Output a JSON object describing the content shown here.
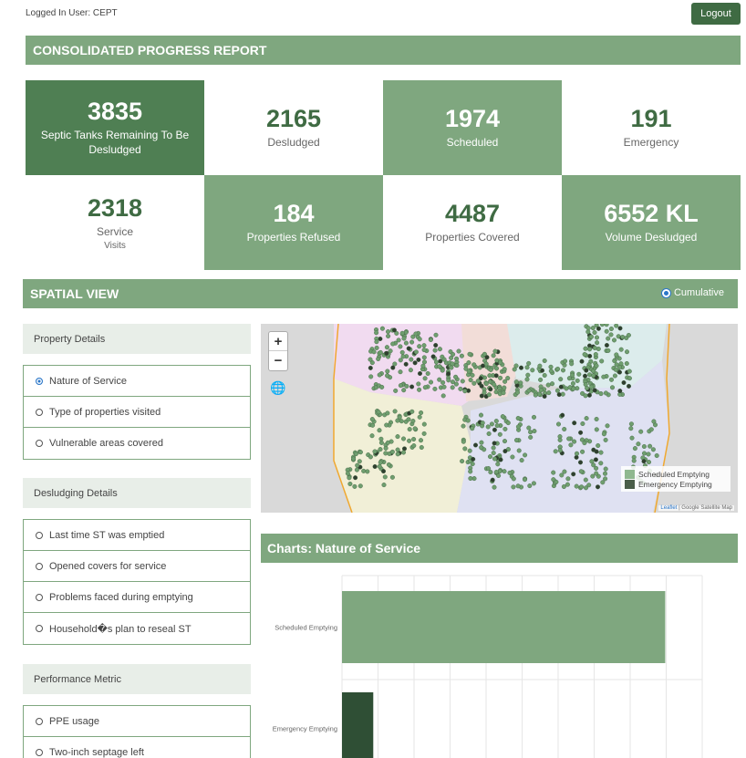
{
  "header": {
    "logged_in": "Logged In User: CEPT",
    "logout": "Logout"
  },
  "report": {
    "title": "CONSOLIDATED PROGRESS REPORT",
    "stats": [
      {
        "value": "3835",
        "label": "Septic Tanks Remaining To Be Desludged",
        "sub": ""
      },
      {
        "value": "2165",
        "label": "Desludged",
        "sub": ""
      },
      {
        "value": "1974",
        "label": "Scheduled",
        "sub": ""
      },
      {
        "value": "191",
        "label": "Emergency",
        "sub": ""
      },
      {
        "value": "2318",
        "label": "Service",
        "sub": "Visits"
      },
      {
        "value": "184",
        "label": "Properties Refused",
        "sub": ""
      },
      {
        "value": "4487",
        "label": "Properties Covered",
        "sub": ""
      },
      {
        "value": "6552 KL",
        "label": "Volume Desludged",
        "sub": ""
      }
    ]
  },
  "spatial": {
    "title": "SPATIAL VIEW",
    "cumulative": "Cumulative"
  },
  "groups": [
    {
      "title": "Property Details",
      "options": [
        "Nature of Service",
        "Type of properties visited",
        "Vulnerable areas covered"
      ],
      "selected": 0
    },
    {
      "title": "Desludging Details",
      "options": [
        "Last time ST was emptied",
        "Opened covers for service",
        "Problems faced during emptying",
        "Household�s plan to reseal ST"
      ],
      "selected": -1
    },
    {
      "title": "Performance Metric",
      "options": [
        "PPE usage",
        "Two-inch septage left"
      ],
      "selected": -1
    }
  ],
  "map": {
    "zoom_in": "+",
    "zoom_out": "−",
    "layers_icon": "globe-icon",
    "legend": [
      {
        "label": "Scheduled Emptying",
        "color": "#8fb88f"
      },
      {
        "label": "Emergency Emptying",
        "color": "#4a5e4a"
      }
    ],
    "attribution_leaflet": "Leaflet",
    "attribution_rest": " | Google Satellite Map"
  },
  "charts": {
    "title": "Charts: Nature of Service"
  },
  "chart_data": {
    "type": "bar",
    "orientation": "horizontal",
    "categories": [
      "Scheduled Emptying",
      "Emergency Emptying"
    ],
    "values": [
      1974,
      191
    ],
    "colors": [
      "#7fa77f",
      "#2f4f35"
    ],
    "xlim": [
      0,
      2200
    ],
    "grid": true
  },
  "colors": {
    "accent": "#7fa77f",
    "dark": "#4f7f53",
    "button": "#3f6b43"
  }
}
